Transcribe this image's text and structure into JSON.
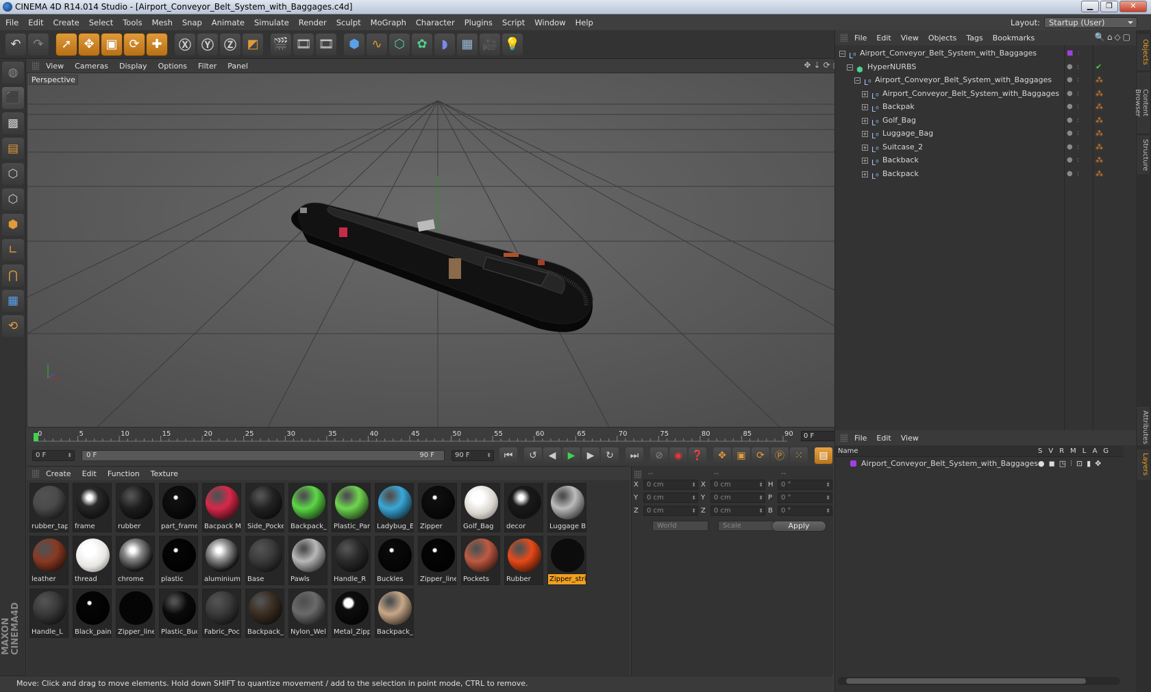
{
  "window": {
    "title": "CINEMA 4D R14.014 Studio - [Airport_Conveyor_Belt_System_with_Baggages.c4d]"
  },
  "menu": [
    "File",
    "Edit",
    "Create",
    "Select",
    "Tools",
    "Mesh",
    "Snap",
    "Animate",
    "Simulate",
    "Render",
    "Sculpt",
    "MoGraph",
    "Character",
    "Plugins",
    "Script",
    "Window",
    "Help"
  ],
  "layout": {
    "label": "Layout:",
    "value": "Startup (User)"
  },
  "viewport": {
    "menu": [
      "View",
      "Cameras",
      "Display",
      "Options",
      "Filter",
      "Panel"
    ],
    "label": "Perspective"
  },
  "timeline": {
    "ticks": [
      "0",
      "5",
      "10",
      "15",
      "20",
      "25",
      "30",
      "35",
      "40",
      "45",
      "50",
      "55",
      "60",
      "65",
      "70",
      "75",
      "80",
      "85",
      "90"
    ],
    "current_frame": "0 F"
  },
  "transport": {
    "start": "0 F",
    "range_start": "0 F",
    "range_end": "90 F",
    "end": "90 F"
  },
  "materials": {
    "menu": [
      "Create",
      "Edit",
      "Function",
      "Texture"
    ],
    "items": [
      {
        "name": "rubber_tap",
        "color": "#4a4a4a",
        "style": "matte"
      },
      {
        "name": "frame",
        "color": "#2a2a2a",
        "style": "chrome"
      },
      {
        "name": "rubber",
        "color": "#1e1e1e",
        "style": "glossy"
      },
      {
        "name": "part_frame",
        "color": "#111111",
        "style": "spot"
      },
      {
        "name": "Bacpack M",
        "color": "#d8284a",
        "style": "dots"
      },
      {
        "name": "Side_Pocke",
        "color": "#222222",
        "style": "fabric"
      },
      {
        "name": "Backpack_S",
        "color": "#5cd846",
        "style": "split"
      },
      {
        "name": "Plastic_Part",
        "color": "#6fd650",
        "style": "green"
      },
      {
        "name": "Ladybug_E",
        "color": "#3aa8d8",
        "style": "blue"
      },
      {
        "name": "Zipper",
        "color": "#101010",
        "style": "spot"
      },
      {
        "name": "Golf_Bag",
        "color": "#d8d4cc",
        "style": "white"
      },
      {
        "name": "decor",
        "color": "#1a1a1a",
        "style": "chrome"
      },
      {
        "name": "Luggage B",
        "color": "#bcbcbc",
        "style": "stripe"
      },
      {
        "name": "leather",
        "color": "#8a3a22",
        "style": "leather"
      },
      {
        "name": "thread",
        "color": "#e8e6e2",
        "style": "white"
      },
      {
        "name": "chrome",
        "color": "#8a8a8a",
        "style": "env"
      },
      {
        "name": "plastic",
        "color": "#050505",
        "style": "spot"
      },
      {
        "name": "aluminium",
        "color": "#9a9a9a",
        "style": "env"
      },
      {
        "name": "Base",
        "color": "#3a3a3a",
        "style": "red-rim"
      },
      {
        "name": "Pawls",
        "color": "#b8b8b8",
        "style": "pawls"
      },
      {
        "name": "Handle_R",
        "color": "#2a2a2a",
        "style": "matte"
      },
      {
        "name": "Buckles",
        "color": "#0a0a0a",
        "style": "spot"
      },
      {
        "name": "Zipper_line",
        "color": "#050505",
        "style": "spot"
      },
      {
        "name": "Pockets",
        "color": "#c05a42",
        "style": "stripe-red"
      },
      {
        "name": "Rubber",
        "color": "#e84a18",
        "style": "orange"
      },
      {
        "name": "Zipper_stri",
        "color": "#0c0c0c",
        "style": "plain"
      },
      {
        "name": "Handle_L",
        "color": "#3a3a3a",
        "style": "red-rim"
      },
      {
        "name": "Black_pain",
        "color": "#050505",
        "style": "spot"
      },
      {
        "name": "Zipper_line",
        "color": "#050505",
        "style": "plain"
      },
      {
        "name": "Plastic_Buc",
        "color": "#0a0a0a",
        "style": "glossy"
      },
      {
        "name": "Fabric_Poc",
        "color": "#3a3a3a",
        "style": "fabric"
      },
      {
        "name": "Backpack_S",
        "color": "#3a2e22",
        "style": "patch"
      },
      {
        "name": "Nylon_Wel",
        "color": "#6a6a6a",
        "style": "matte-light"
      },
      {
        "name": "Metal_Zipp",
        "color": "#0e0e0e",
        "style": "spot-big"
      },
      {
        "name": "Backpack_I",
        "color": "#c8a888",
        "style": "tan"
      }
    ],
    "selected": "Zipper_stri"
  },
  "coords": {
    "headers": [
      "--",
      "--",
      "--"
    ],
    "rows": [
      {
        "a": "X",
        "v1": "0 cm",
        "b": "X",
        "v2": "0 cm",
        "c": "H",
        "v3": "0 °"
      },
      {
        "a": "Y",
        "v1": "0 cm",
        "b": "Y",
        "v2": "0 cm",
        "c": "P",
        "v3": "0 °"
      },
      {
        "a": "Z",
        "v1": "0 cm",
        "b": "Z",
        "v2": "0 cm",
        "c": "B",
        "v3": "0 °"
      }
    ],
    "space": "World",
    "mode": "Scale",
    "apply": "Apply"
  },
  "objects": {
    "menu": [
      "File",
      "Edit",
      "View",
      "Objects",
      "Tags",
      "Bookmarks"
    ],
    "rows": [
      {
        "name": "Airport_Conveyor_Belt_System_with_Baggages",
        "depth": 0,
        "icon": "null",
        "expand": "−"
      },
      {
        "name": "HyperNURBS",
        "depth": 1,
        "icon": "nurbs",
        "expand": "−"
      },
      {
        "name": "Airport_Conveyor_Belt_System_with_Baggages",
        "depth": 2,
        "icon": "null",
        "expand": "−"
      },
      {
        "name": "Airport_Conveyor_Belt_System_with_Baggages",
        "depth": 3,
        "icon": "null",
        "expand": "+"
      },
      {
        "name": "Backpak",
        "depth": 3,
        "icon": "null",
        "expand": "+"
      },
      {
        "name": "Golf_Bag",
        "depth": 3,
        "icon": "null",
        "expand": "+"
      },
      {
        "name": "Luggage_Bag",
        "depth": 3,
        "icon": "null",
        "expand": "+"
      },
      {
        "name": "Suitcase_2",
        "depth": 3,
        "icon": "null",
        "expand": "+"
      },
      {
        "name": "Backback",
        "depth": 3,
        "icon": "null",
        "expand": "+"
      },
      {
        "name": "Backpack",
        "depth": 3,
        "icon": "null",
        "expand": "+"
      }
    ]
  },
  "layers": {
    "menu": [
      "File",
      "Edit",
      "View"
    ],
    "header_name": "Name",
    "header_cols": "SVRMLAG",
    "row": "Airport_Conveyor_Belt_System_with_Baggages"
  },
  "sidetabs": [
    "Objects",
    "Content Browser",
    "Structure",
    "Attributes",
    "Layers"
  ],
  "status": "Move: Click and drag to move elements. Hold down SHIFT to quantize movement / add to the selection in point mode, CTRL to remove."
}
